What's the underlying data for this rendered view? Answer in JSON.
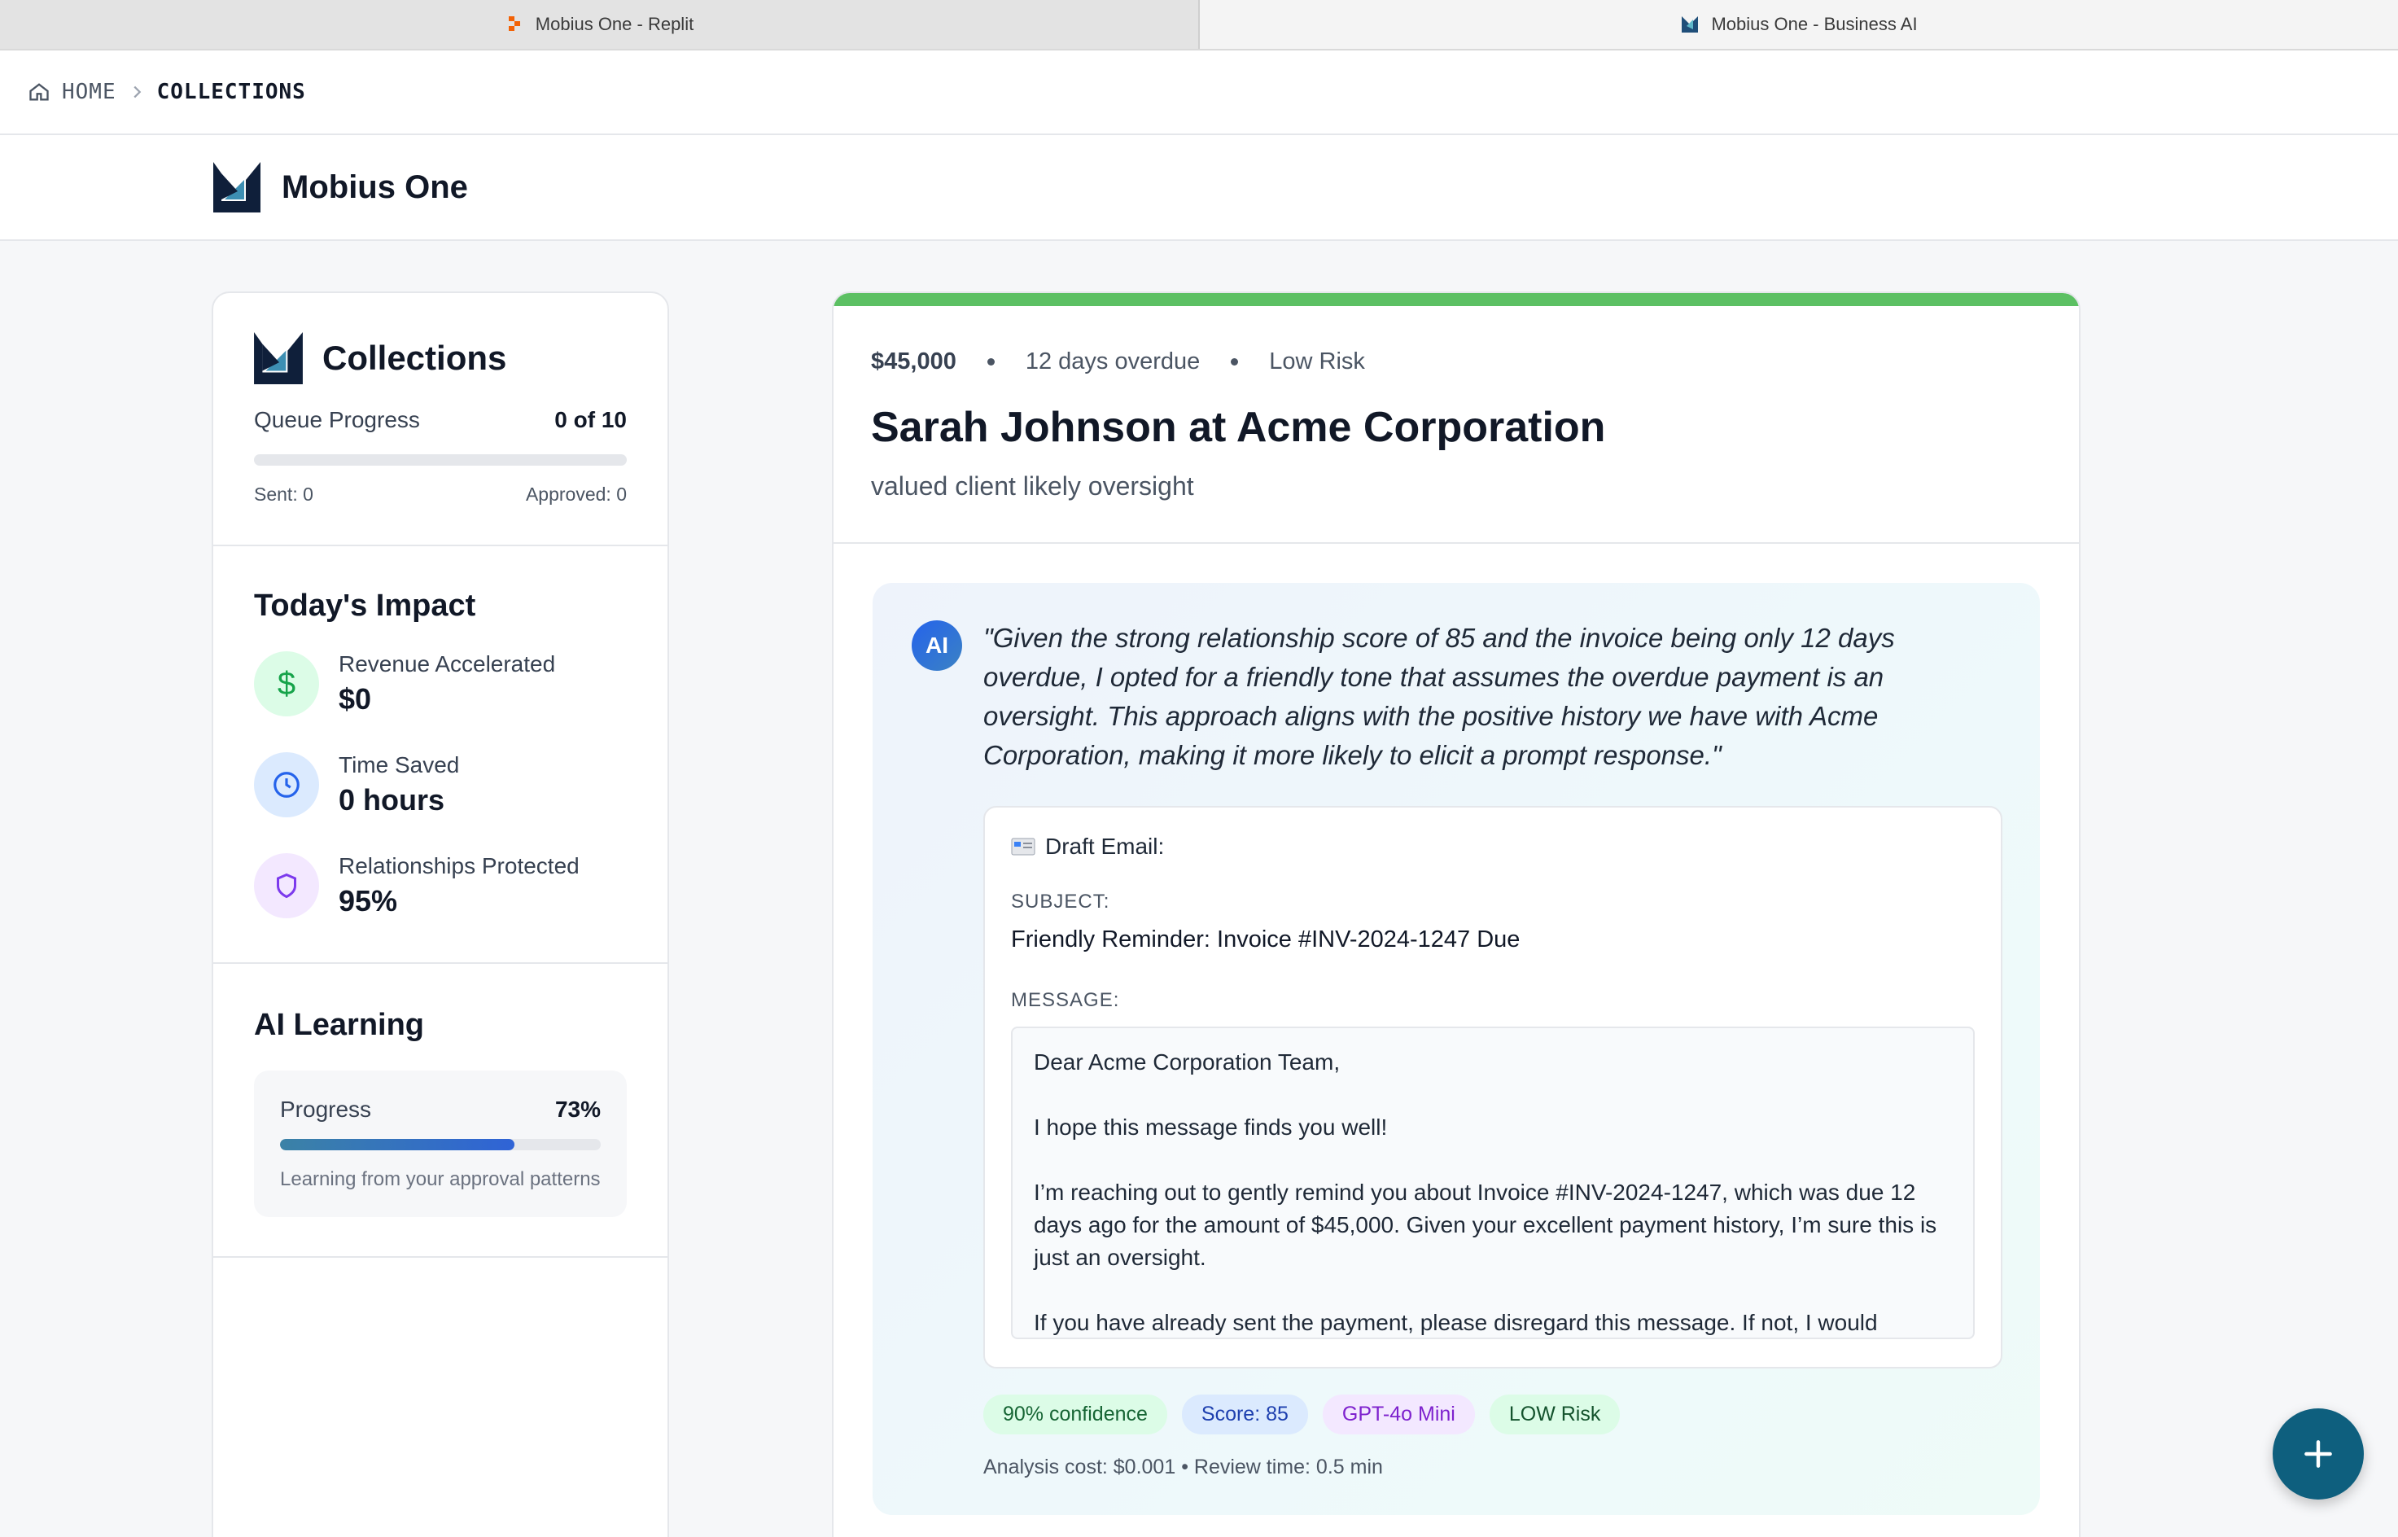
{
  "tabs": [
    {
      "title": "Mobius One - Replit"
    },
    {
      "title": "Mobius One - Business AI"
    }
  ],
  "breadcrumb": {
    "home": "HOME",
    "current": "COLLECTIONS",
    "icons": [
      "home-icon",
      "chevron-right-icon"
    ]
  },
  "app": {
    "name": "Mobius One",
    "logo": "mobius-logo"
  },
  "sidebar": {
    "collections": {
      "title": "Collections",
      "queue_label": "Queue Progress",
      "queue_value": "0 of 10",
      "queue_fraction": 0,
      "sent": "Sent: 0",
      "approved": "Approved: 0"
    },
    "impact": {
      "title": "Today's Impact",
      "items": [
        {
          "label": "Revenue Accelerated",
          "value": "$0",
          "icon": "dollar-icon",
          "color": "#16a34a"
        },
        {
          "label": "Time Saved",
          "value": "0 hours",
          "icon": "clock-icon",
          "color": "#2563eb"
        },
        {
          "label": "Relationships Protected",
          "value": "95%",
          "icon": "shield-icon",
          "color": "#7c3aed"
        }
      ]
    },
    "learning": {
      "title": "AI Learning",
      "progress_label": "Progress",
      "progress_value": "73%",
      "progress_fraction": 0.73,
      "note": "Learning from your approval patterns"
    }
  },
  "item": {
    "amount": "$45,000",
    "overdue": "12 days overdue",
    "risk": "Low Risk",
    "status_color": "#5cc063",
    "name": "Sarah Johnson at Acme Corporation",
    "tagline": "valued client likely oversight"
  },
  "ai": {
    "avatar": "AI",
    "rationale": "\"Given the strong relationship score of 85 and the invoice being only 12 days overdue, I opted for a friendly tone that assumes the overdue payment is an oversight. This approach aligns with the positive history we have with Acme Corporation, making it more likely to elicit a prompt response.\"",
    "draft": {
      "heading": "Draft Email:",
      "subject_label": "SUBJECT:",
      "subject": "Friendly Reminder: Invoice #INV-2024-1247 Due",
      "message_label": "MESSAGE:",
      "message": [
        "Dear Acme Corporation Team,",
        "I hope this message finds you well!",
        "I’m reaching out to gently remind you about Invoice #INV-2024-1247, which was due 12 days ago for the amount of $45,000. Given your excellent payment history, I’m sure this is just an oversight.",
        "If you have already sent the payment, please disregard this message. If not, I would"
      ]
    },
    "chips": [
      "90% confidence",
      "Score: 85",
      "GPT-4o Mini",
      "LOW Risk"
    ],
    "cost": "Analysis cost: $0.001 • Review time: 0.5 min"
  },
  "fab": {
    "icon": "plus-icon"
  }
}
